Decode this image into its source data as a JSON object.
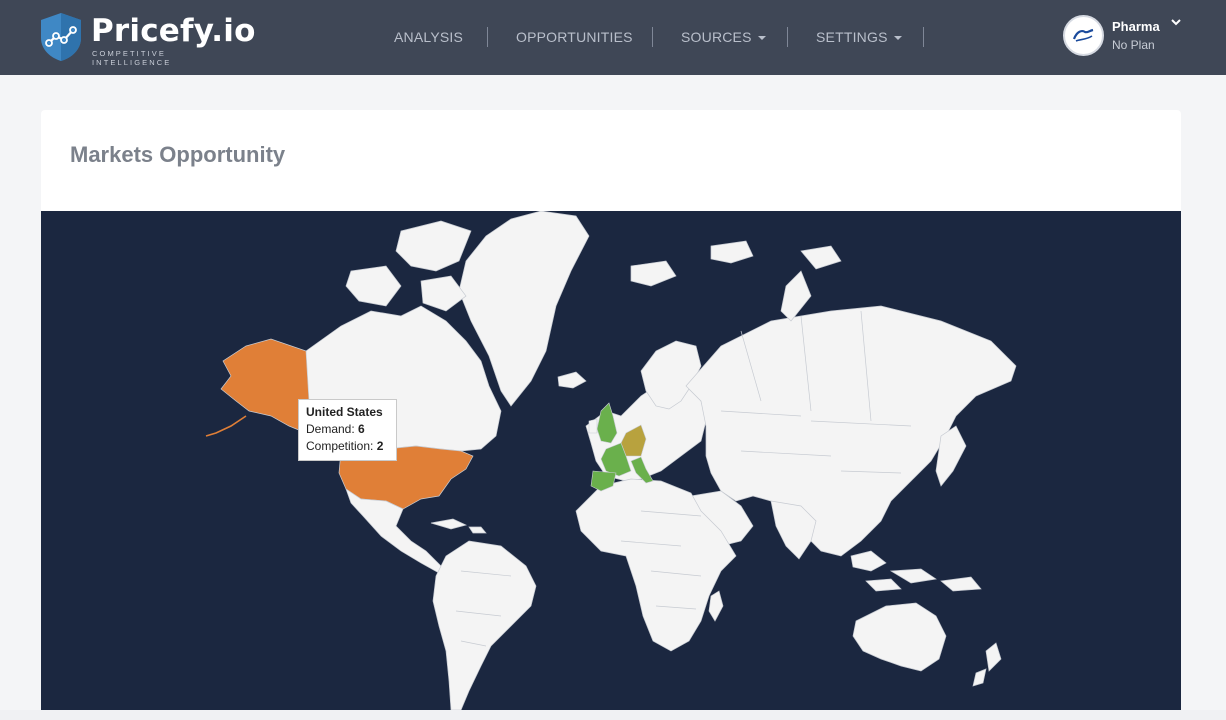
{
  "header": {
    "logo_name": "Pricefy.io",
    "logo_tagline": "COMPETITIVE INTELLIGENCE",
    "nav": [
      {
        "label": "ANALYSIS",
        "has_dropdown": false
      },
      {
        "label": "OPPORTUNITIES",
        "has_dropdown": false
      },
      {
        "label": "SOURCES",
        "has_dropdown": true
      },
      {
        "label": "SETTINGS",
        "has_dropdown": true
      }
    ],
    "account": {
      "name": "Pharma",
      "plan": "No Plan",
      "avatar_logo": "boots-logo"
    }
  },
  "main": {
    "title": "Markets Opportunity",
    "map": {
      "ocean_color": "#1b2740",
      "land_color": "#f4f4f4",
      "highlighted_regions": [
        {
          "name": "United States",
          "color": "#e07f37"
        },
        {
          "name": "United Kingdom",
          "color": "#6ab04c"
        },
        {
          "name": "France",
          "color": "#6ab04c"
        },
        {
          "name": "Spain",
          "color": "#6ab04c"
        },
        {
          "name": "Italy",
          "color": "#6ab04c"
        },
        {
          "name": "Germany",
          "color": "#b8a23e"
        }
      ],
      "tooltip": {
        "country": "United States",
        "demand_label": "Demand:",
        "demand_value": "6",
        "competition_label": "Competition:",
        "competition_value": "2"
      }
    }
  }
}
